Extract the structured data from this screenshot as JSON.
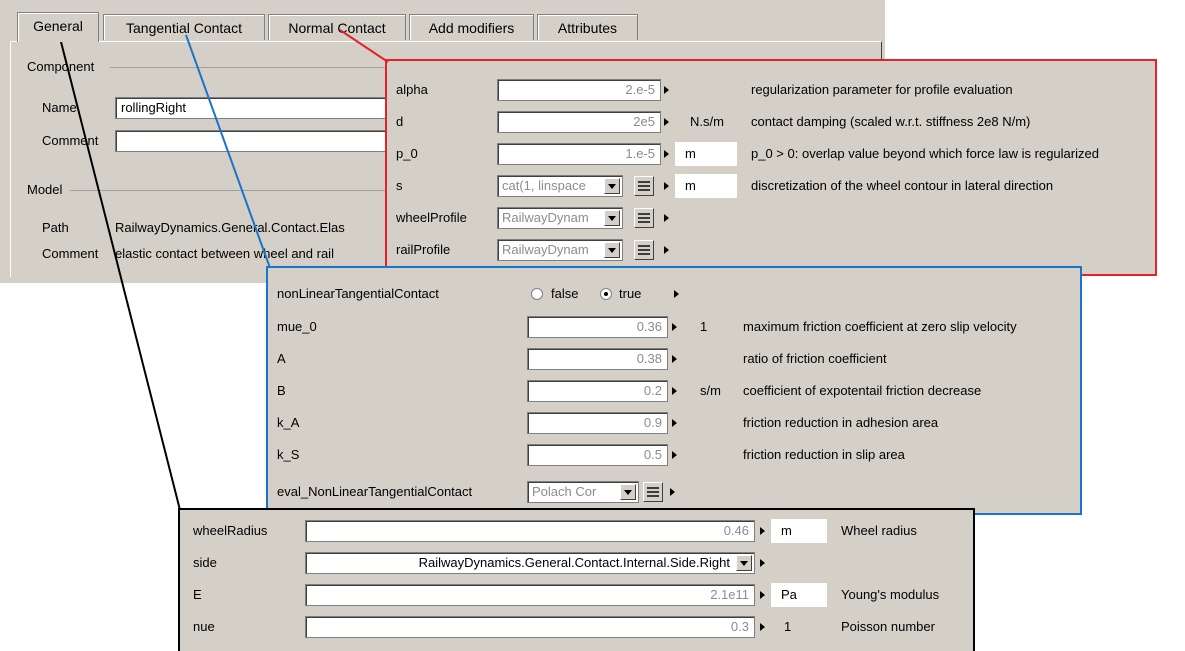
{
  "tabs": [
    "General",
    "Tangential Contact",
    "Normal Contact",
    "Add modifiers",
    "Attributes"
  ],
  "general": {
    "component_group": "Component",
    "name_label": "Name",
    "name_value": "rollingRight",
    "comment_label": "Comment",
    "comment_value": "",
    "model_group": "Model",
    "path_label": "Path",
    "path_value": "RailwayDynamics.General.Contact.Elas",
    "model_comment_label": "Comment",
    "model_comment_value": "elastic contact between wheel and rail"
  },
  "normal_contact": {
    "border_color": "#e8202a",
    "rows": [
      {
        "name": "alpha",
        "value": "2.e-5",
        "unit": "",
        "desc": "regularization parameter for profile evaluation"
      },
      {
        "name": "d",
        "value": "2e5",
        "unit": "N.s/m",
        "desc": "contact damping (scaled w.r.t. stiffness 2e8 N/m)"
      },
      {
        "name": "p_0",
        "value": "1.e-5",
        "unit": "m",
        "desc": "p_0 > 0: overlap value beyond which force law is regularized"
      },
      {
        "name": "s",
        "value": "cat(1, linspace",
        "unit": "m",
        "desc": "discretization of the wheel contour in lateral direction"
      },
      {
        "name": "wheelProfile",
        "value": "RailwayDynam",
        "unit": "",
        "desc": ""
      },
      {
        "name": "railProfile",
        "value": "RailwayDynam",
        "unit": "",
        "desc": ""
      }
    ]
  },
  "tangential_contact": {
    "border_color": "#1a74c8",
    "nonlinear_label": "nonLinearTangentialContact",
    "false_label": "false",
    "true_label": "true",
    "rows": [
      {
        "name": "mue_0",
        "value": "0.36",
        "unit": "1",
        "desc": "maximum friction coefficient at zero slip velocity"
      },
      {
        "name": "A",
        "value": "0.38",
        "unit": "",
        "desc": "ratio of friction coefficient"
      },
      {
        "name": "B",
        "value": "0.2",
        "unit": "s/m",
        "desc": "coefficient of expotentail friction decrease"
      },
      {
        "name": "k_A",
        "value": "0.9",
        "unit": "",
        "desc": "friction reduction in adhesion area"
      },
      {
        "name": "k_S",
        "value": "0.5",
        "unit": "",
        "desc": "friction reduction in slip area"
      }
    ],
    "eval_label": "eval_NonLinearTangentialContact",
    "eval_value": "Polach Cor"
  },
  "wheel_params": {
    "border_color": "#000000",
    "rows": [
      {
        "name": "wheelRadius",
        "value": "0.46",
        "unit": "m",
        "desc": "Wheel radius"
      },
      {
        "name": "side",
        "value": "RailwayDynamics.General.Contact.Internal.Side.Right",
        "unit": "",
        "desc": ""
      },
      {
        "name": "E",
        "value": "2.1e11",
        "unit": "Pa",
        "desc": "Young's modulus"
      },
      {
        "name": "nue",
        "value": "0.3",
        "unit": "1",
        "desc": "Poisson number"
      }
    ]
  },
  "callout_colors": {
    "general": "#000000",
    "tangential": "#1a74c8",
    "normal": "#e8202a"
  }
}
